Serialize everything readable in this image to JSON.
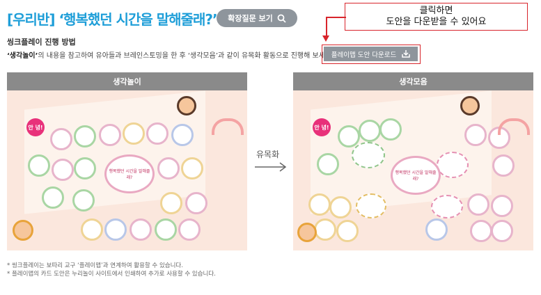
{
  "header": {
    "title": "[우리반] ‘행복했던 시간을 말해줄래?’",
    "ext_button_label": "확장질문 보기",
    "ext_button_icon": "search-icon"
  },
  "callout": {
    "line1": "클릭하면",
    "line2": "도안을 다운받을 수 있어요"
  },
  "section": {
    "subtitle": "씽크플레이 진행 방법",
    "desc_bold": "‘생각놀이’",
    "desc_rest": "의 내용을 참고하여 유아들과 브레인스토밍을 한 후 ‘생각모음’과 같이 유목화 활동으로 진행해 보세요."
  },
  "download": {
    "label": "플레이맵 도안 다운로드",
    "icon": "download-icon"
  },
  "panels": {
    "left_title": "생각놀이",
    "right_title": "생각모음",
    "center_label": "유목화",
    "badge_greeting": "안 녕!",
    "playmap_center_text": "행복했던 시간을 말해줄래?"
  },
  "notes": [
    "* 씽크플레이는 보따리 교구 ‘플레이맵’과 연계하여 활용할 수 있습니다.",
    "* 플레이맵의 카드 도안은 누리놀이 사이트에서 인쇄하여 추가로 사용할 수 있습니다."
  ],
  "colors": {
    "title_blue": "#1e9ed8",
    "button_gray": "#8e959c",
    "highlight_red": "#d8242b",
    "panel_bg": "#fbe7dd"
  }
}
